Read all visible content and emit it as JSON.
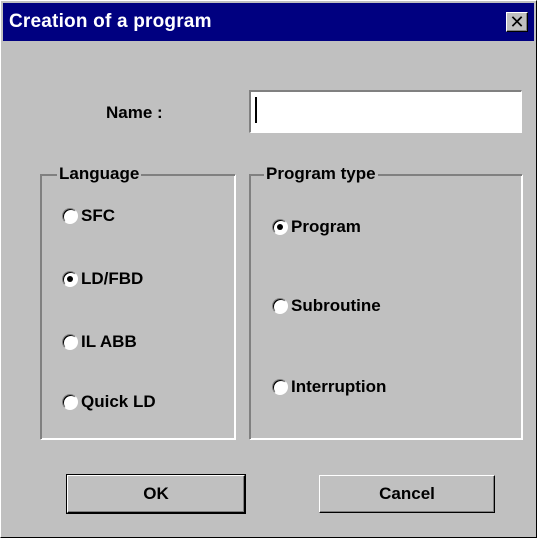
{
  "window": {
    "title": "Creation of a program",
    "close_glyph": "✕"
  },
  "name_field": {
    "label": "Name :",
    "value": ""
  },
  "language_group": {
    "label": "Language",
    "options": [
      {
        "label": "SFC",
        "selected": false
      },
      {
        "label": "LD/FBD",
        "selected": true
      },
      {
        "label": "IL ABB",
        "selected": false
      },
      {
        "label": "Quick LD",
        "selected": false
      }
    ]
  },
  "program_type_group": {
    "label": "Program type",
    "options": [
      {
        "label": "Program",
        "selected": true
      },
      {
        "label": "Subroutine",
        "selected": false
      },
      {
        "label": "Interruption",
        "selected": false
      }
    ]
  },
  "buttons": {
    "ok_label": "OK",
    "cancel_label": "Cancel"
  },
  "colors": {
    "titlebar": "#000080",
    "face": "#c0c0c0"
  }
}
